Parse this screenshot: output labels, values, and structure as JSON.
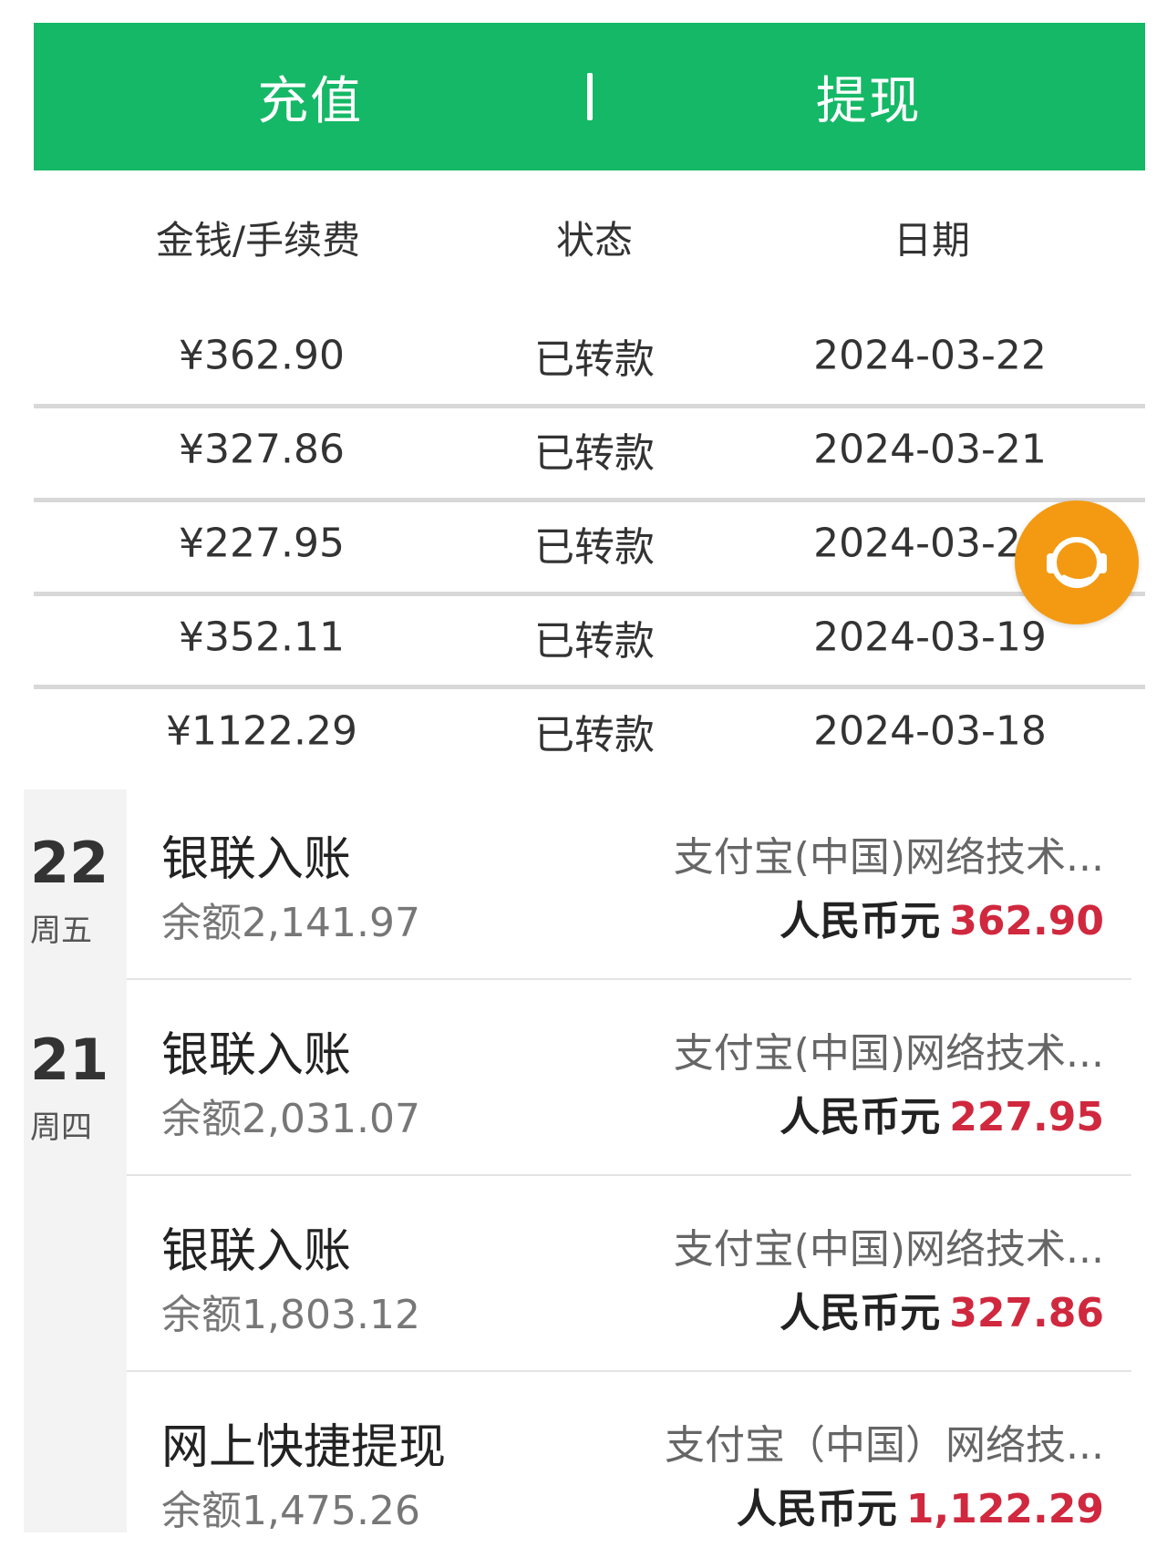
{
  "tabs": {
    "recharge": "充值",
    "separator": "|",
    "withdraw": "提现"
  },
  "columns": {
    "amount": "金钱/手续费",
    "status": "状态",
    "date": "日期"
  },
  "withdrawals": [
    {
      "amount": "¥362.90",
      "status": "已转款",
      "date": "2024-03-22"
    },
    {
      "amount": "¥327.86",
      "status": "已转款",
      "date": "2024-03-21"
    },
    {
      "amount": "¥227.95",
      "status": "已转款",
      "date": "2024-03-20"
    },
    {
      "amount": "¥352.11",
      "status": "已转款",
      "date": "2024-03-19"
    },
    {
      "amount": "¥1122.29",
      "status": "已转款",
      "date": "2024-03-18"
    }
  ],
  "support_button": {
    "icon": "headset-icon",
    "color": "#f39a12"
  },
  "dates": [
    {
      "day": "22",
      "weekday": "周五"
    },
    {
      "day": "21",
      "weekday": "周四"
    }
  ],
  "transactions": [
    {
      "title": "银联入账",
      "balance": "余额2,141.97",
      "merchant": "支付宝(中国)网络技术...",
      "currency": "人民币元",
      "amount": "362.90"
    },
    {
      "title": "银联入账",
      "balance": "余额2,031.07",
      "merchant": "支付宝(中国)网络技术...",
      "currency": "人民币元",
      "amount": "227.95"
    },
    {
      "title": "银联入账",
      "balance": "余额1,803.12",
      "merchant": "支付宝(中国)网络技术...",
      "currency": "人民币元",
      "amount": "327.86"
    },
    {
      "title": "网上快捷提现",
      "balance": "余额1,475.26",
      "merchant": "支付宝（中国）网络技...",
      "currency": "人民币元",
      "amount": "1,122.29"
    }
  ],
  "colors": {
    "brand_green": "#15b866",
    "amount_red": "#d0283e",
    "fab_orange": "#f39a12"
  }
}
